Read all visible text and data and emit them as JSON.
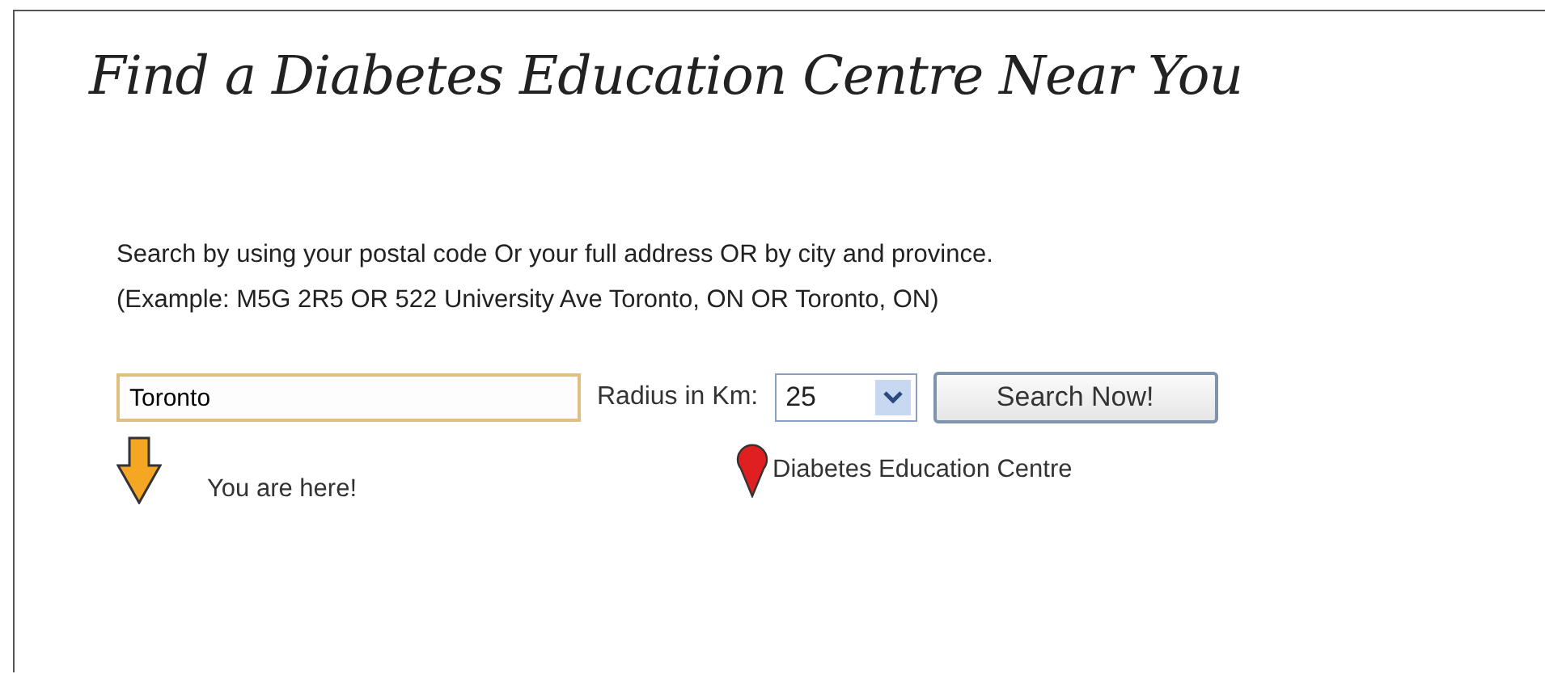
{
  "title": "Find a Diabetes Education Centre Near You",
  "instructions": [
    "Search by using your postal code Or your full address OR by city and province.",
    "(Example: M5G 2R5 OR 522 University Ave Toronto, ON OR Toronto, ON)"
  ],
  "search": {
    "value": "Toronto",
    "radius_label": "Radius in Km:",
    "radius": "25",
    "button": "Search Now!"
  },
  "legend": [
    {
      "kind": "arrow",
      "label": "You are here!"
    },
    {
      "kind": "pin",
      "label": "Diabetes Education Centre"
    }
  ]
}
